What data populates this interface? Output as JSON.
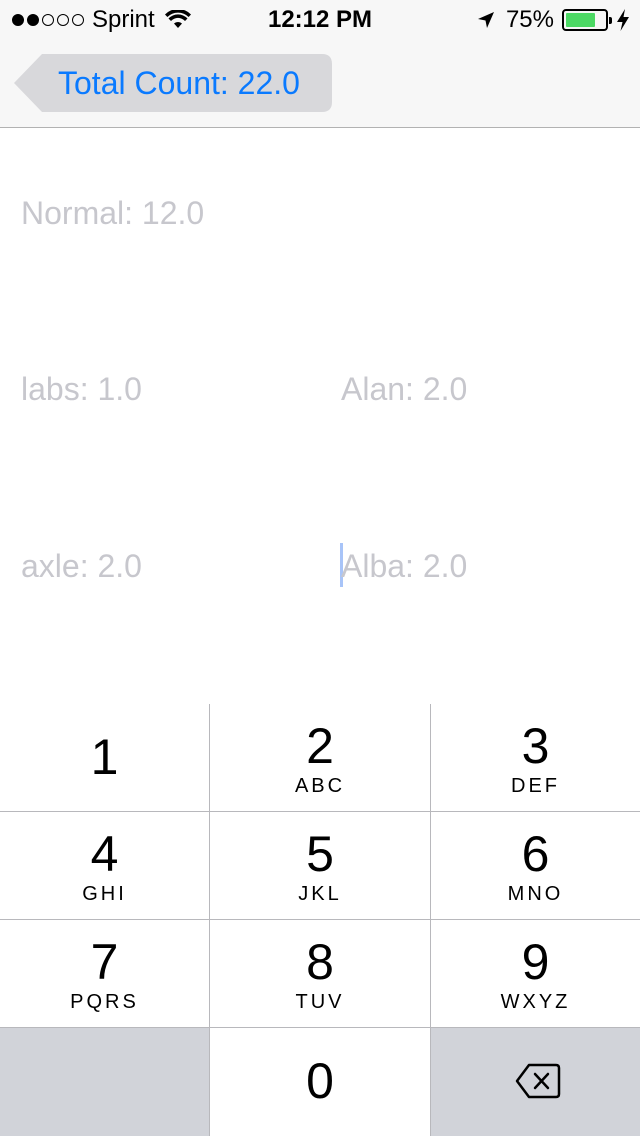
{
  "status_bar": {
    "carrier": "Sprint",
    "time": "12:12 PM",
    "battery_percent": "75%",
    "battery_level": 0.75,
    "signal_bars_filled": 2,
    "signal_bars_total": 5,
    "battery_color": "#4cd964"
  },
  "nav": {
    "back_label": "Total Count: 22.0",
    "accent_color": "#0a7aff"
  },
  "fields": {
    "normal": "Normal: 12.0",
    "labs": "labs: 1.0",
    "alan": "Alan: 2.0",
    "axle": "axle: 2.0",
    "alba": "Alba: 2.0"
  },
  "keypad": {
    "keys": [
      {
        "num": "1",
        "letters": ""
      },
      {
        "num": "2",
        "letters": "ABC"
      },
      {
        "num": "3",
        "letters": "DEF"
      },
      {
        "num": "4",
        "letters": "GHI"
      },
      {
        "num": "5",
        "letters": "JKL"
      },
      {
        "num": "6",
        "letters": "MNO"
      },
      {
        "num": "7",
        "letters": "PQRS"
      },
      {
        "num": "8",
        "letters": "TUV"
      },
      {
        "num": "9",
        "letters": "WXYZ"
      },
      {
        "num": "0",
        "letters": ""
      }
    ],
    "delete_icon": "delete-backspace-icon"
  }
}
